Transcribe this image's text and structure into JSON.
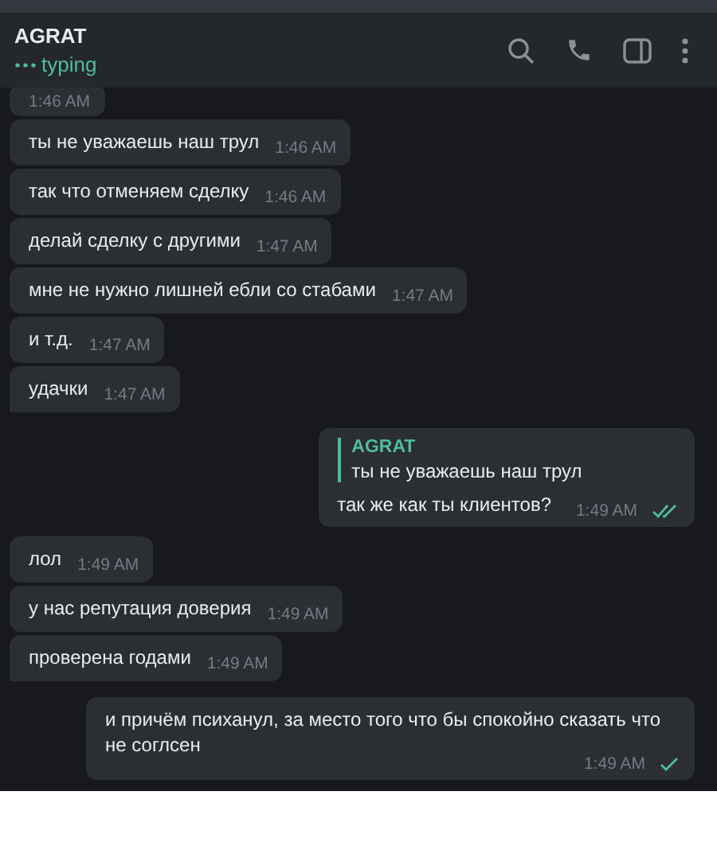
{
  "header": {
    "name": "AGRAT",
    "status": "typing"
  },
  "messages": [
    {
      "kind": "in",
      "partial": true,
      "time": "1:46 AM",
      "tail": false
    },
    {
      "kind": "in",
      "text": "ты не уважаешь наш трул",
      "time": "1:46 AM",
      "tail": false
    },
    {
      "kind": "in",
      "text": "так что отменяем сделку",
      "time": "1:46 AM",
      "tail": false
    },
    {
      "kind": "in",
      "text": "делай сделку с другими",
      "time": "1:47 AM",
      "tail": false
    },
    {
      "kind": "in",
      "text": "мне не нужно лишней ебли со стабами",
      "time": "1:47 AM",
      "tail": false
    },
    {
      "kind": "in",
      "text": "и т.д.",
      "time": "1:47 AM",
      "tail": false
    },
    {
      "kind": "in",
      "text": "удачки",
      "time": "1:47 AM",
      "tail": true
    },
    {
      "kind": "out",
      "reply": {
        "author": "AGRAT",
        "text": "ты не уважаешь наш трул"
      },
      "text": "так же как ты клиентов?",
      "time": "1:49 AM",
      "read": true,
      "tail": false
    },
    {
      "kind": "in",
      "text": "лол",
      "time": "1:49 AM",
      "tail": false
    },
    {
      "kind": "in",
      "text": "у нас репутация доверия",
      "time": "1:49 AM",
      "tail": false
    },
    {
      "kind": "in",
      "text": "проверена годами",
      "time": "1:49 AM",
      "tail": true
    },
    {
      "kind": "out",
      "text": "и причём психанул, за место того что бы спокойно сказать что не соглсен",
      "time": "1:49 AM",
      "read": false,
      "tail": false
    }
  ]
}
